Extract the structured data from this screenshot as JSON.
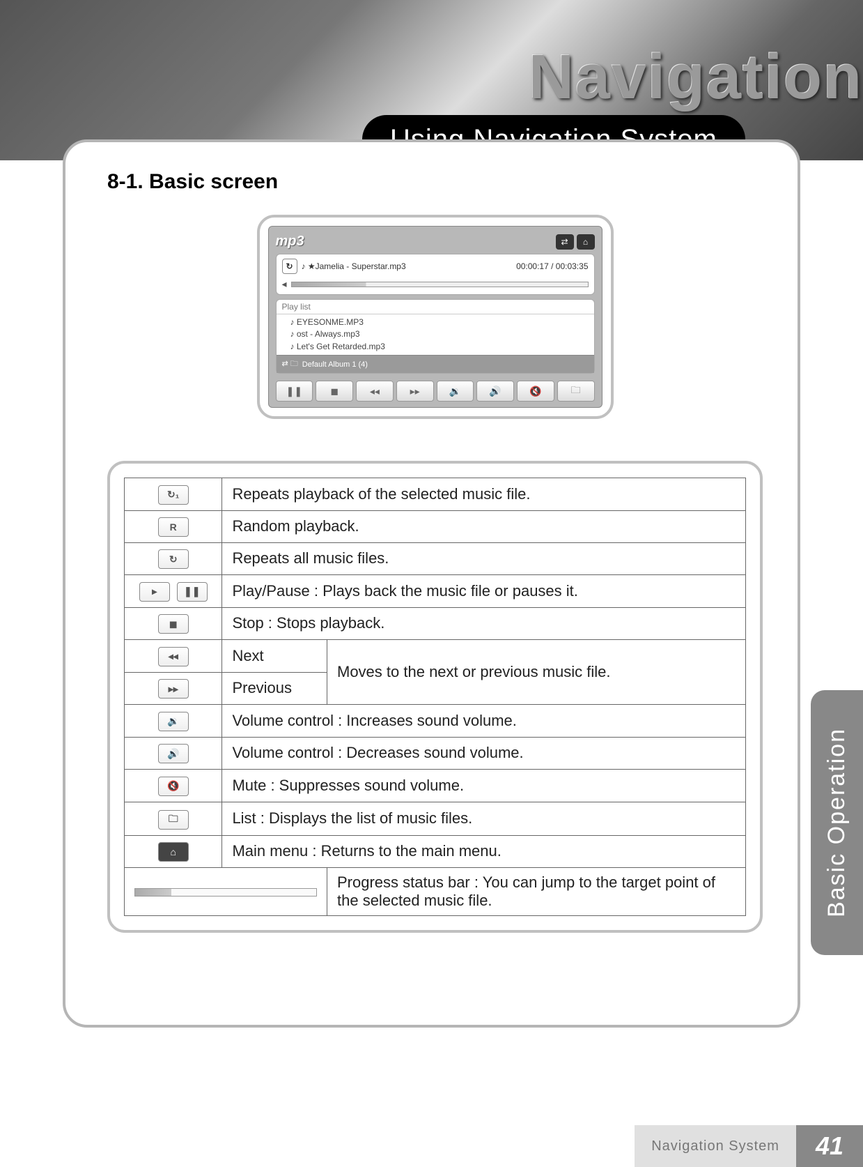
{
  "hero": {
    "title": "Navigation",
    "subtitle": "Using Navigation System"
  },
  "section_title": "8-1. Basic screen",
  "screenshot": {
    "app": "mp3",
    "now_playing": "★Jamelia - Superstar.mp3",
    "time": "00:00:17 / 00:03:35",
    "playlist_label": "Play list",
    "tracks": [
      "EYESONME.MP3",
      "ost - Always.mp3",
      "Let's Get Retarded.mp3"
    ],
    "album": "Default Album 1 (4)"
  },
  "table": {
    "repeat1": "Repeats playback of the selected music file.",
    "random": "Random playback.",
    "repeat_all": "Repeats all music files.",
    "play_pause": "Play/Pause : Plays back the music file or pauses it.",
    "stop": "Stop : Stops playback.",
    "next": "Next",
    "previous": "Previous",
    "next_prev_desc": "Moves to the next or previous music file.",
    "vol_up": "Volume control : Increases sound volume.",
    "vol_down": "Volume control : Decreases sound volume.",
    "mute": "Mute : Suppresses sound volume.",
    "list": "List : Displays the list of music files.",
    "main_menu": "Main menu : Returns to the main menu.",
    "progress": "Progress status bar : You can jump to the target point of the selected music file."
  },
  "side_tab": "Basic Operation",
  "footer": {
    "label": "Navigation System",
    "page": "41"
  }
}
